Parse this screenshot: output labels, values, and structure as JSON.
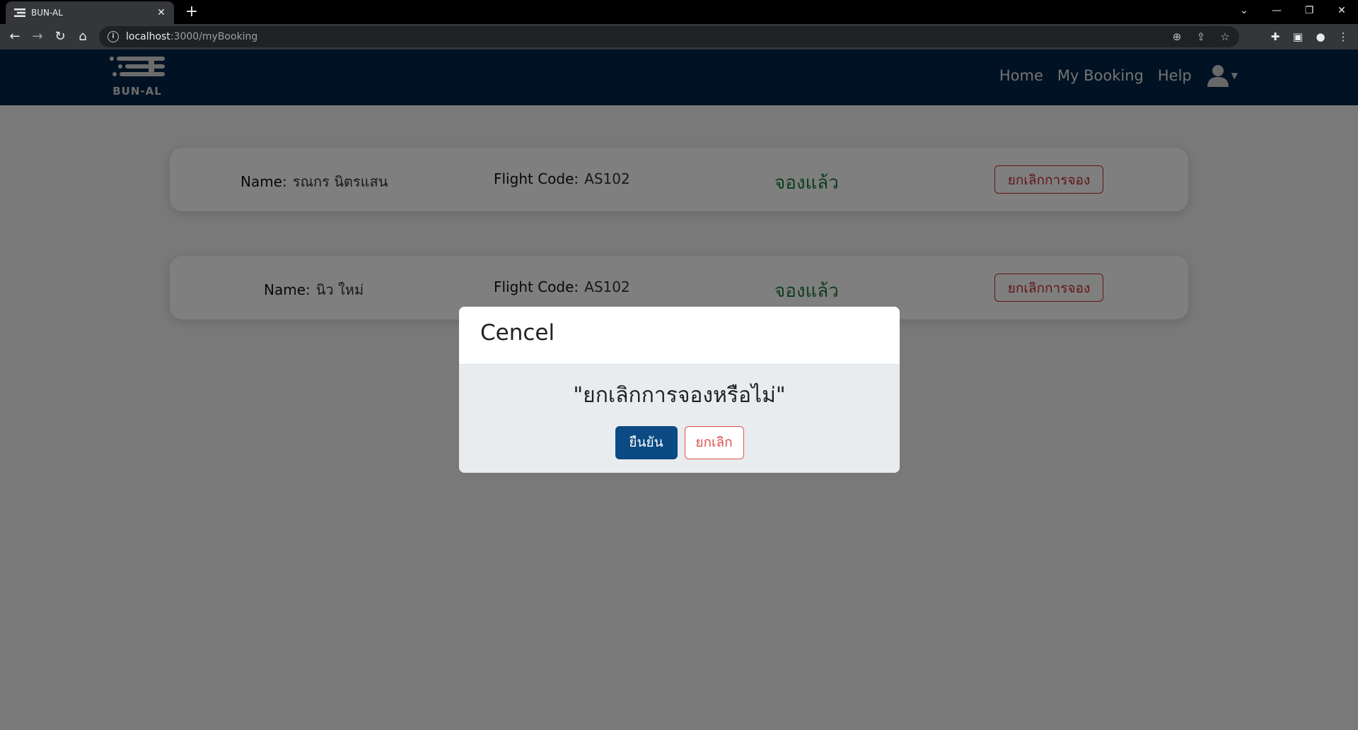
{
  "browser": {
    "tab_title": "BUN-AL",
    "url_host": "localhost",
    "url_path": ":3000/myBooking"
  },
  "app": {
    "logo_text": "BUN-AL",
    "nav": {
      "home": "Home",
      "my_booking": "My Booking",
      "help": "Help"
    }
  },
  "bookings": [
    {
      "name_label": "Name:",
      "name": "รณกร นิตรแสน",
      "flight_label": "Flight Code:",
      "flight_code": "AS102",
      "status": "จองแล้ว",
      "cancel_label": "ยกเลิกการจอง"
    },
    {
      "name_label": "Name:",
      "name": "นิว ใหม่",
      "flight_label": "Flight Code:",
      "flight_code": "AS102",
      "status": "จองแล้ว",
      "cancel_label": "ยกเลิกการจอง"
    }
  ],
  "modal": {
    "title": "Cencel",
    "message": "\"ยกเลิกการจองหรือไม่\"",
    "confirm_label": "ยืนยัน",
    "dismiss_label": "ยกเลิก"
  },
  "colors": {
    "navbar": "#002547",
    "status_booked": "#1f7a3c",
    "cancel": "#c62828",
    "confirm": "#0b4a82"
  }
}
